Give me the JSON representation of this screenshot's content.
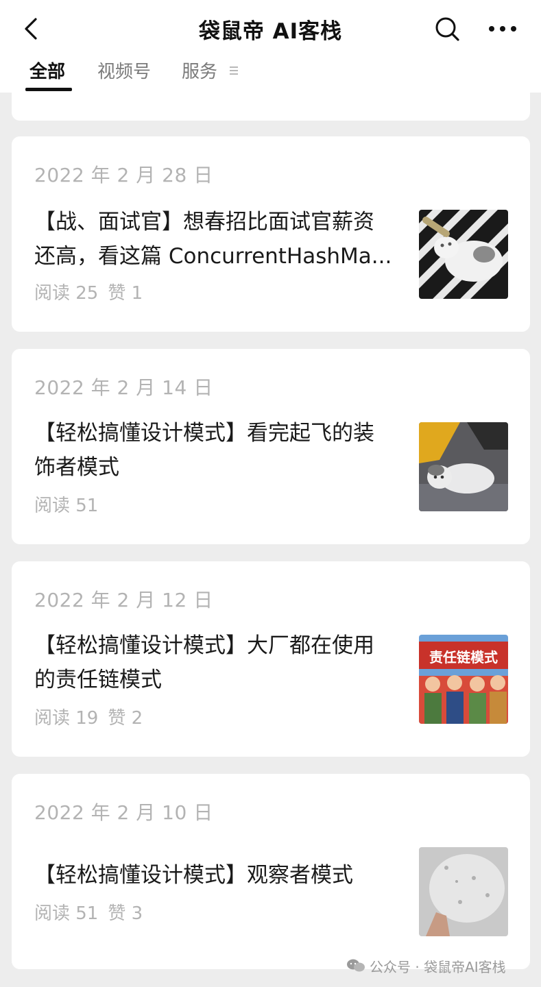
{
  "header": {
    "title": "袋鼠帝 AI客栈",
    "tabs": [
      {
        "label": "全部",
        "active": true
      },
      {
        "label": "视频号",
        "active": false
      },
      {
        "label": "服务",
        "active": false
      }
    ],
    "tab_menu_icon": "hamburger-icon",
    "back_icon": "chevron-left-icon",
    "search_icon": "search-icon",
    "more_icon": "more-dots-icon"
  },
  "articles": [
    {
      "date": "2022 年 2 月 28 日",
      "title_lines": [
        "【战、面试官】想春招比面试官薪资",
        "还高，看这篇 ConcurrentHashMa..."
      ],
      "read": "阅读 25",
      "like": "赞 1",
      "thumb": "cat-on-pattern-image"
    },
    {
      "date": "2022 年 2 月 14 日",
      "title_lines": [
        "【轻松搞懂设计模式】看完起飞的装",
        "饰者模式"
      ],
      "read": "阅读 51",
      "like": "",
      "thumb": "cat-lying-image"
    },
    {
      "date": "2022 年 2 月 12 日",
      "title_lines": [
        "【轻松搞懂设计模式】大厂都在使用",
        "的责任链模式"
      ],
      "read": "阅读 19",
      "like": "赞 2",
      "thumb": "chain-pattern-poster-image",
      "thumb_text": "责任链模式"
    },
    {
      "date": "2022 年 2 月 10 日",
      "title_lines": [
        "【轻松搞懂设计模式】观察者模式"
      ],
      "read": "阅读 51",
      "like": "赞 3",
      "thumb": "gray-texture-image"
    }
  ],
  "watermark": {
    "icon": "wechat-icon",
    "text": "公众号 · 袋鼠帝AI客栈"
  }
}
